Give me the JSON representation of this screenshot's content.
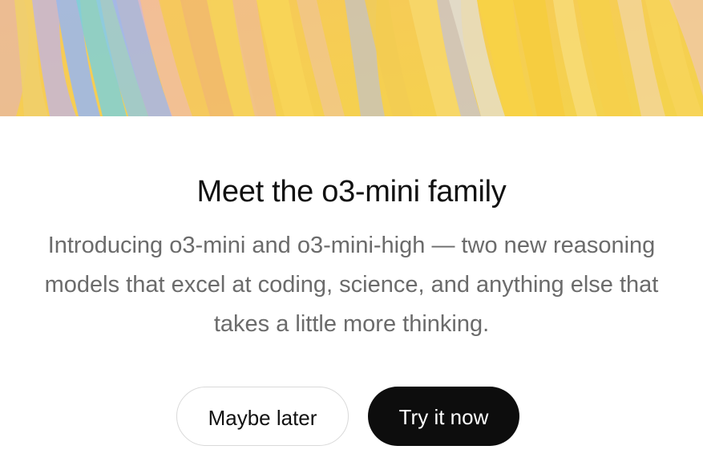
{
  "dialog": {
    "title": "Meet the o3-mini family",
    "description": "Introducing o3-mini and o3-mini-high — two new reasoning models that excel at coding, science, and anything else that takes a little more thinking.",
    "secondary_button_label": "Maybe later",
    "primary_button_label": "Try it now"
  },
  "colors": {
    "primary_button_bg": "#0d0d0d",
    "primary_button_text": "#ffffff",
    "secondary_button_border": "#d9d9d9",
    "title_text": "#111111",
    "description_text": "#6b6b6b",
    "hero_yellow": "#f6cf48",
    "hero_blue": "#8fb3e8",
    "hero_teal": "#7dcfd6"
  }
}
